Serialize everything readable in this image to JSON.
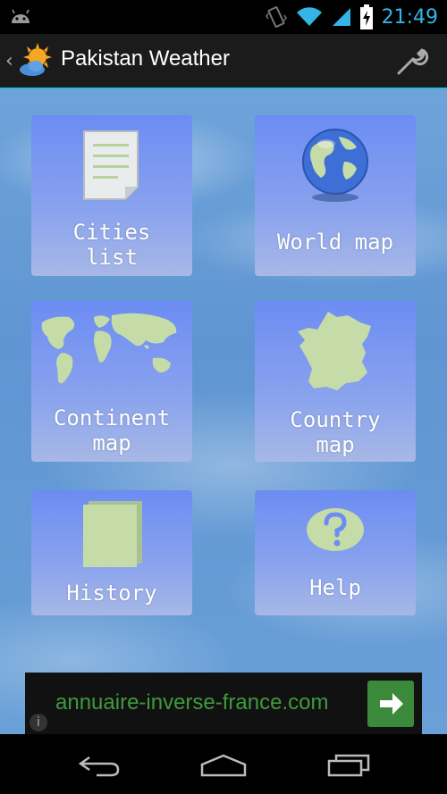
{
  "status_bar": {
    "time": "21:49",
    "icons": [
      "android-icon",
      "vibrate-icon",
      "wifi-icon",
      "signal-icon",
      "battery-charging-icon"
    ]
  },
  "action_bar": {
    "title": "Pakistan Weather",
    "logo_icon": "weather-sun-cloud-icon",
    "settings_icon": "wrench-icon"
  },
  "tiles": [
    {
      "label": "Cities\nlist",
      "icon": "document-list-icon"
    },
    {
      "label": "World map",
      "icon": "globe-icon"
    },
    {
      "label": "Continent\nmap",
      "icon": "world-map-icon"
    },
    {
      "label": "Country\nmap",
      "icon": "france-map-icon"
    },
    {
      "label": "History",
      "icon": "book-icon"
    },
    {
      "label": "Help",
      "icon": "question-bubble-icon"
    }
  ],
  "ad": {
    "text": "annuaire-inverse-france.com",
    "button_icon": "arrow-right-icon",
    "info_icon": "info-icon"
  },
  "nav": {
    "icons": [
      "back-icon",
      "home-icon",
      "recents-icon"
    ]
  },
  "colors": {
    "accent": "#33b5e5",
    "tile_top": "#6c8cf3",
    "tile_bottom": "#a7b8e6",
    "icon_fill": "#c5dba8",
    "ad_text": "#3f9a3f"
  }
}
